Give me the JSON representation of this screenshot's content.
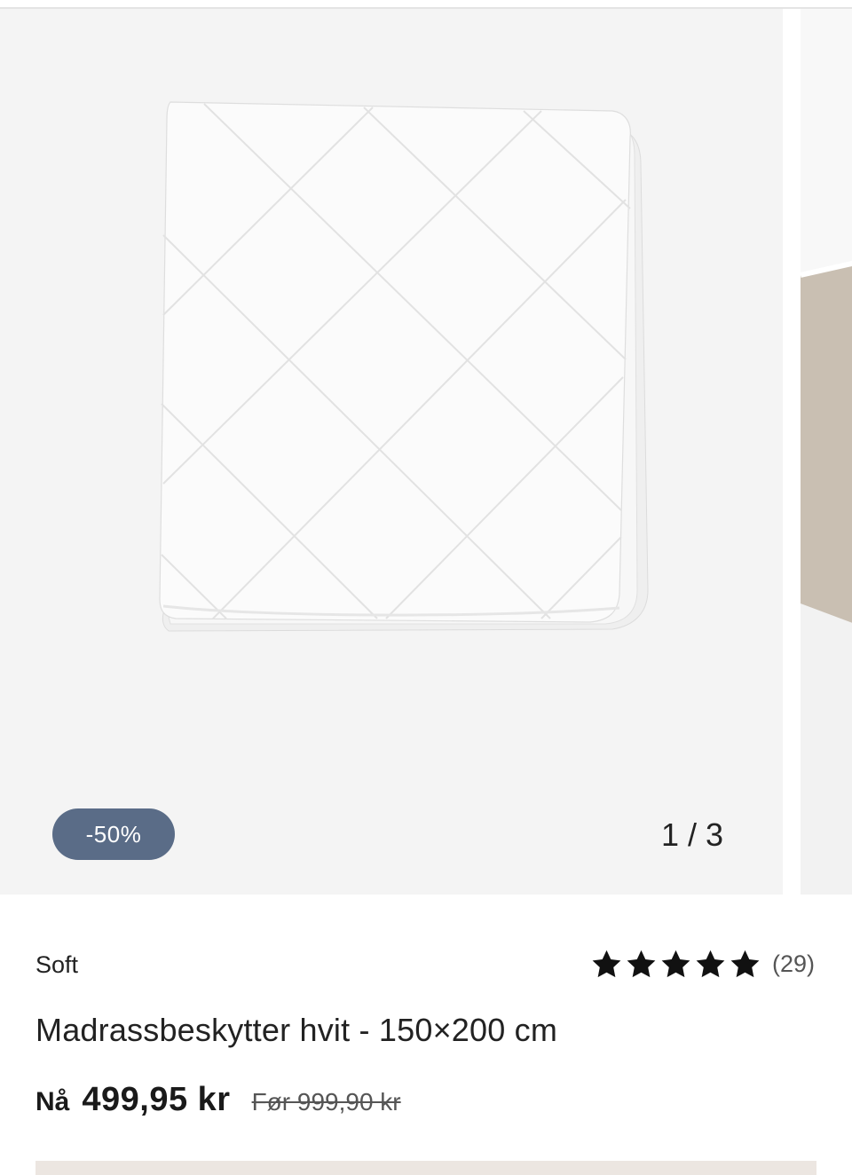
{
  "gallery": {
    "discount_badge": "-50%",
    "counter": "1 / 3",
    "current_index": 1,
    "total": 3
  },
  "product": {
    "brand": "Soft",
    "title": "Madrassbeskytter hvit - 150×200 cm",
    "rating": {
      "stars": 5,
      "max_stars": 5,
      "count_label": "(29)"
    },
    "price": {
      "prefix": "Nå",
      "current": "499,95 kr",
      "before": "Før 999,90 kr"
    }
  },
  "colors": {
    "badge_bg": "#5a6c87",
    "image_bg": "#f4f4f4",
    "text": "#222222"
  },
  "icons": {
    "star": "star-filled-icon"
  }
}
